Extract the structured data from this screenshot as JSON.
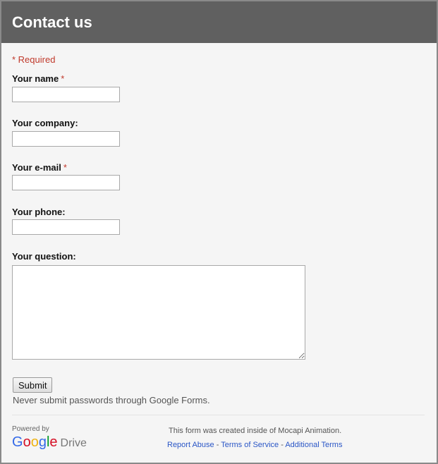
{
  "header": {
    "title": "Contact us"
  },
  "form": {
    "required_note": "* Required",
    "required_star": "*",
    "fields": [
      {
        "label": "Your name",
        "required": true,
        "value": ""
      },
      {
        "label": "Your company:",
        "required": false,
        "value": ""
      },
      {
        "label": "Your e-mail",
        "required": true,
        "value": ""
      },
      {
        "label": "Your phone:",
        "required": false,
        "value": ""
      },
      {
        "label": "Your question:",
        "required": false,
        "value": ""
      }
    ],
    "submit_label": "Submit",
    "password_warning": "Never submit passwords through Google Forms."
  },
  "footer": {
    "powered_by": "Powered by",
    "logo": {
      "letters": [
        "G",
        "o",
        "o",
        "g",
        "l",
        "e"
      ],
      "product": "Drive"
    },
    "created_text": "This form was created inside of Mocapi Animation.",
    "links": {
      "report_abuse": "Report Abuse",
      "terms_of_service": "Terms of Service",
      "additional_terms": "Additional Terms",
      "separator": " - "
    }
  },
  "colors": {
    "header_bg": "#606060",
    "required": "#c0392b",
    "link": "#2a56c6"
  }
}
